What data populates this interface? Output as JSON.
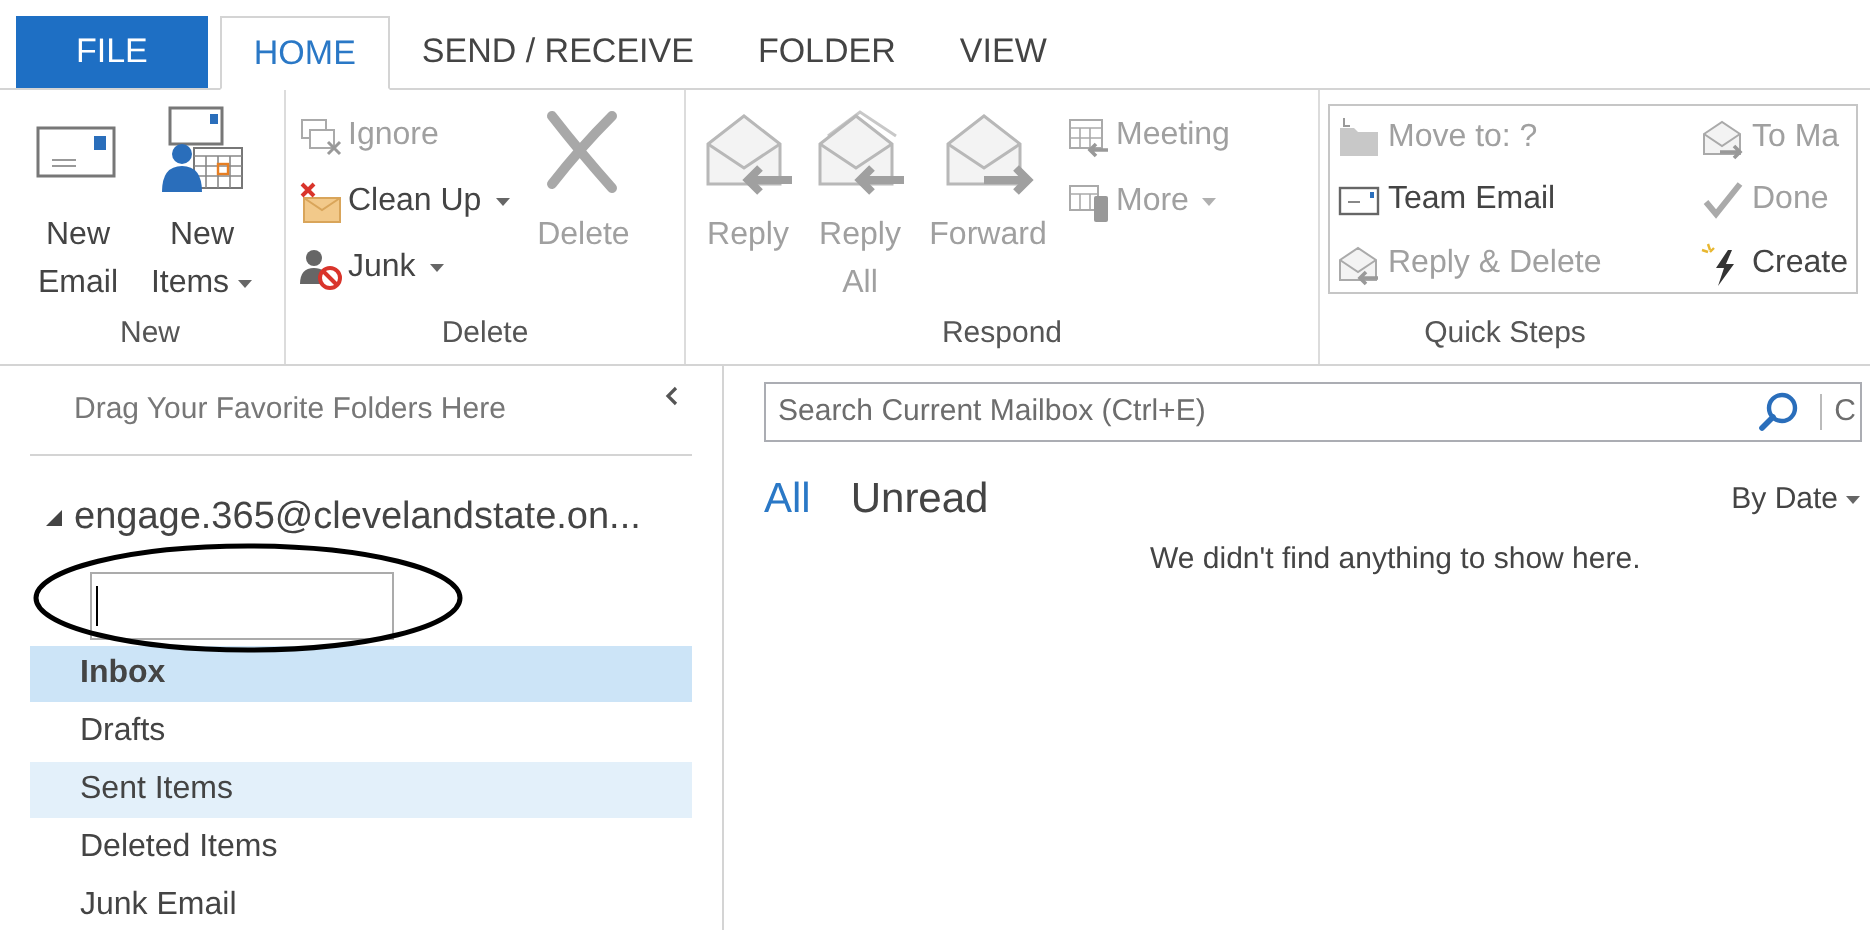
{
  "tabs": [
    {
      "label": "FILE",
      "kind": "backstage",
      "selected": false
    },
    {
      "label": "HOME",
      "kind": "tab",
      "selected": true
    },
    {
      "label": "SEND / RECEIVE",
      "kind": "tab",
      "selected": false
    },
    {
      "label": "FOLDER",
      "kind": "tab",
      "selected": false
    },
    {
      "label": "VIEW",
      "kind": "tab",
      "selected": false
    }
  ],
  "ribbon": {
    "groups": [
      {
        "label": "New",
        "items": [
          {
            "kind": "large",
            "label": "New Email",
            "disabled": false,
            "dropdown": false
          },
          {
            "kind": "large",
            "label": "New Items",
            "disabled": false,
            "dropdown": true
          }
        ]
      },
      {
        "label": "Delete",
        "items": [
          {
            "kind": "small",
            "label": "Ignore",
            "disabled": true,
            "dropdown": false
          },
          {
            "kind": "small",
            "label": "Clean Up",
            "disabled": false,
            "dropdown": true
          },
          {
            "kind": "small",
            "label": "Junk",
            "disabled": false,
            "dropdown": true
          },
          {
            "kind": "large",
            "label": "Delete",
            "disabled": true,
            "dropdown": false
          }
        ]
      },
      {
        "label": "Respond",
        "items": [
          {
            "kind": "large",
            "label": "Reply",
            "disabled": true,
            "dropdown": false
          },
          {
            "kind": "large",
            "label": "Reply All",
            "disabled": true,
            "dropdown": false
          },
          {
            "kind": "large",
            "label": "Forward",
            "disabled": true,
            "dropdown": false
          },
          {
            "kind": "small",
            "label": "Meeting",
            "disabled": true,
            "dropdown": false
          },
          {
            "kind": "small",
            "label": "More",
            "disabled": true,
            "dropdown": true
          }
        ]
      },
      {
        "label": "Quick Steps",
        "items": [
          {
            "kind": "quickstep",
            "label": "Move to: ?",
            "disabled": true
          },
          {
            "kind": "quickstep",
            "label": "Team Email",
            "disabled": false
          },
          {
            "kind": "quickstep",
            "label": "Reply & Delete",
            "disabled": true
          },
          {
            "kind": "quickstep",
            "label": "To Ma",
            "disabled": true
          },
          {
            "kind": "quickstep",
            "label": "Done",
            "disabled": true
          },
          {
            "kind": "quickstep",
            "label": "Create",
            "disabled": false
          }
        ]
      }
    ]
  },
  "favorites": {
    "hint": "Drag Your Favorite Folders Here"
  },
  "account": {
    "name": "engage.365@clevelandstate.on...",
    "expanded": true
  },
  "new_folder_field": {
    "focused": true
  },
  "folders": [
    {
      "label": "Inbox",
      "selected": true,
      "hovered": false,
      "unread": true
    },
    {
      "label": "Drafts",
      "selected": false,
      "hovered": false,
      "unread": false
    },
    {
      "label": "Sent Items",
      "selected": false,
      "hovered": true,
      "unread": false
    },
    {
      "label": "Deleted Items",
      "selected": false,
      "hovered": false,
      "unread": false
    },
    {
      "label": "Junk Email",
      "selected": false,
      "hovered": false,
      "unread": false
    }
  ],
  "search": {
    "placeholder": "Search Current Mailbox (Ctrl+E)",
    "scope": "C"
  },
  "filters": [
    {
      "label": "All",
      "selected": true
    },
    {
      "label": "Unread",
      "selected": false
    }
  ],
  "sort": {
    "label": "By Date",
    "dropdown": true
  },
  "empty_message": "We didn't find anything to show here."
}
